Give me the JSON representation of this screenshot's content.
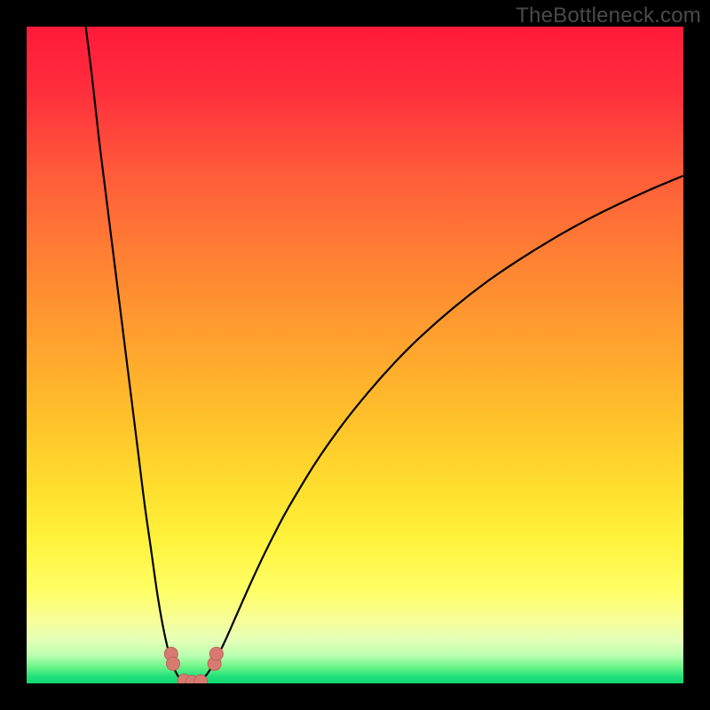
{
  "watermark": "TheBottleneck.com",
  "colors": {
    "bg": "#000000",
    "curve_stroke": "#000000",
    "marker_fill": "#d77b71",
    "marker_stroke": "#c35f56",
    "gradient_stops": [
      {
        "offset": 0.0,
        "color": "#ff1a3a"
      },
      {
        "offset": 0.1,
        "color": "#ff2f3c"
      },
      {
        "offset": 0.22,
        "color": "#ff5a3a"
      },
      {
        "offset": 0.35,
        "color": "#ff8033"
      },
      {
        "offset": 0.48,
        "color": "#ffa22e"
      },
      {
        "offset": 0.6,
        "color": "#ffc22a"
      },
      {
        "offset": 0.7,
        "color": "#ffde2e"
      },
      {
        "offset": 0.78,
        "color": "#fff23b"
      },
      {
        "offset": 0.86,
        "color": "#ffff66"
      },
      {
        "offset": 0.905,
        "color": "#f6ff9a"
      },
      {
        "offset": 0.935,
        "color": "#e4ffb8"
      },
      {
        "offset": 0.958,
        "color": "#b8ffb0"
      },
      {
        "offset": 0.975,
        "color": "#6cf588"
      },
      {
        "offset": 0.99,
        "color": "#20e07a"
      },
      {
        "offset": 1.0,
        "color": "#0fd873"
      }
    ]
  },
  "chart_data": {
    "type": "line",
    "title": "",
    "xlabel": "",
    "ylabel": "",
    "xlim": [
      0,
      100
    ],
    "ylim": [
      0,
      100
    ],
    "series": [
      {
        "name": "bottleneck-curve",
        "x": [
          9,
          10,
          11,
          12,
          13,
          14,
          15,
          16,
          17,
          18,
          19,
          20,
          21,
          22,
          23,
          24,
          25,
          26,
          27,
          28,
          30,
          32,
          34,
          36,
          38,
          40,
          44,
          48,
          52,
          56,
          60,
          65,
          70,
          75,
          80,
          85,
          90,
          95,
          100
        ],
        "y": [
          100,
          92,
          83,
          75,
          67,
          59,
          51,
          43,
          35,
          27,
          20,
          13,
          7.5,
          3.5,
          1.2,
          0.3,
          0.0,
          0.2,
          0.9,
          2.2,
          6.0,
          10.5,
          15.0,
          19.3,
          23.3,
          27.0,
          33.6,
          39.3,
          44.3,
          48.8,
          52.8,
          57.2,
          61.1,
          64.5,
          67.6,
          70.4,
          72.9,
          75.2,
          77.3
        ]
      }
    ],
    "markers": [
      {
        "name": "left-cluster",
        "x": 22.0,
        "y": 4.5
      },
      {
        "name": "left-cluster",
        "x": 22.3,
        "y": 3.0
      },
      {
        "name": "floor-left",
        "x": 24.0,
        "y": 0.4
      },
      {
        "name": "floor-mid",
        "x": 25.2,
        "y": 0.2
      },
      {
        "name": "floor-right",
        "x": 26.5,
        "y": 0.3
      },
      {
        "name": "right-cluster",
        "x": 28.6,
        "y": 3.0
      },
      {
        "name": "right-cluster",
        "x": 28.9,
        "y": 4.5
      }
    ]
  }
}
